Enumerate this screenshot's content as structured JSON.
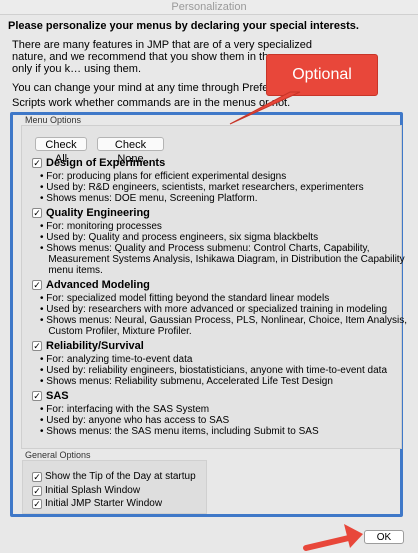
{
  "window": {
    "title": "Personalization"
  },
  "intro": {
    "heading": "Please personalize your menus by declaring your special interests.",
    "p1": "There are many features in JMP that are of a very specialized nature, and we recommend that you show them in the menus only if you k… using them.",
    "p2": "You can change your mind at any time through Preferences",
    "p3": "Scripts work whether commands are in the menus or not."
  },
  "annotation": {
    "bubble_text": "Optional",
    "accent_color": "#e8473a",
    "frame_color": "#3f78c8"
  },
  "menu_options": {
    "label": "Menu Options",
    "check_all_label": "Check All",
    "check_none_label": "Check None",
    "categories": [
      {
        "name": "Design of Experiments",
        "checked": true,
        "bullets": [
          "• For: producing plans for efficient experimental designs",
          "• Used by: R&D engineers, scientists, market researchers, experimenters",
          "• Shows menus: DOE menu, Screening Platform."
        ]
      },
      {
        "name": "Quality Engineering",
        "checked": true,
        "bullets": [
          "• For: monitoring processes",
          "• Used by: Quality and process engineers, six sigma blackbelts",
          "• Shows menus: Quality and Process submenu: Control Charts, Capability,",
          "   Measurement Systems Analysis, Ishikawa Diagram, in Distribution the Capability",
          "   menu items."
        ]
      },
      {
        "name": "Advanced Modeling",
        "checked": true,
        "bullets": [
          "• For: specialized model fitting beyond the standard linear models",
          "• Used by: researchers with more advanced or specialized training in modeling",
          "• Shows menus: Neural, Gaussian Process, PLS, Nonlinear, Choice, Item Analysis,",
          "   Custom Profiler, Mixture Profiler."
        ]
      },
      {
        "name": "Reliability/Survival",
        "checked": true,
        "bullets": [
          "• For: analyzing time-to-event data",
          "• Used by: reliability engineers, biostatisticians, anyone with time-to-event data",
          "• Shows menus: Reliability submenu, Accelerated Life Test Design"
        ]
      },
      {
        "name": "SAS",
        "checked": true,
        "bullets": [
          "• For: interfacing with the SAS System",
          "• Used by: anyone who has access to SAS",
          "• Shows menus: the SAS menu items, including Submit to SAS"
        ]
      }
    ]
  },
  "general_options": {
    "label": "General Options",
    "items": [
      {
        "label": "Show the Tip of the Day at startup",
        "checked": true
      },
      {
        "label": "Initial Splash Window",
        "checked": true
      },
      {
        "label": "Initial JMP Starter Window",
        "checked": true
      }
    ]
  },
  "ok_label": "OK"
}
